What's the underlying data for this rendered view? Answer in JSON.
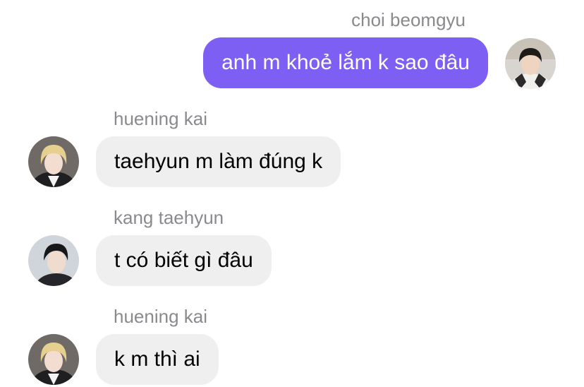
{
  "messages": [
    {
      "sender": "choi beomgyu",
      "text": "anh m khoẻ lắm k sao đâu",
      "direction": "outgoing",
      "avatar": "person-photo-dark-hair-avatar"
    },
    {
      "sender": "huening kai",
      "text": "taehyun m làm đúng k",
      "direction": "incoming",
      "avatar": "person-photo-blonde-hair-avatar"
    },
    {
      "sender": "kang taehyun",
      "text": "t có biết gì đâu",
      "direction": "incoming",
      "avatar": "person-photo-dark-hair-avatar"
    },
    {
      "sender": "huening kai",
      "text": "k m thì ai",
      "direction": "incoming",
      "avatar": "person-photo-blonde-hair-avatar"
    }
  ],
  "colors": {
    "outgoing_bubble": "#7d5ff3",
    "incoming_bubble": "#efeff0",
    "sender_name": "#8a8a8e"
  }
}
